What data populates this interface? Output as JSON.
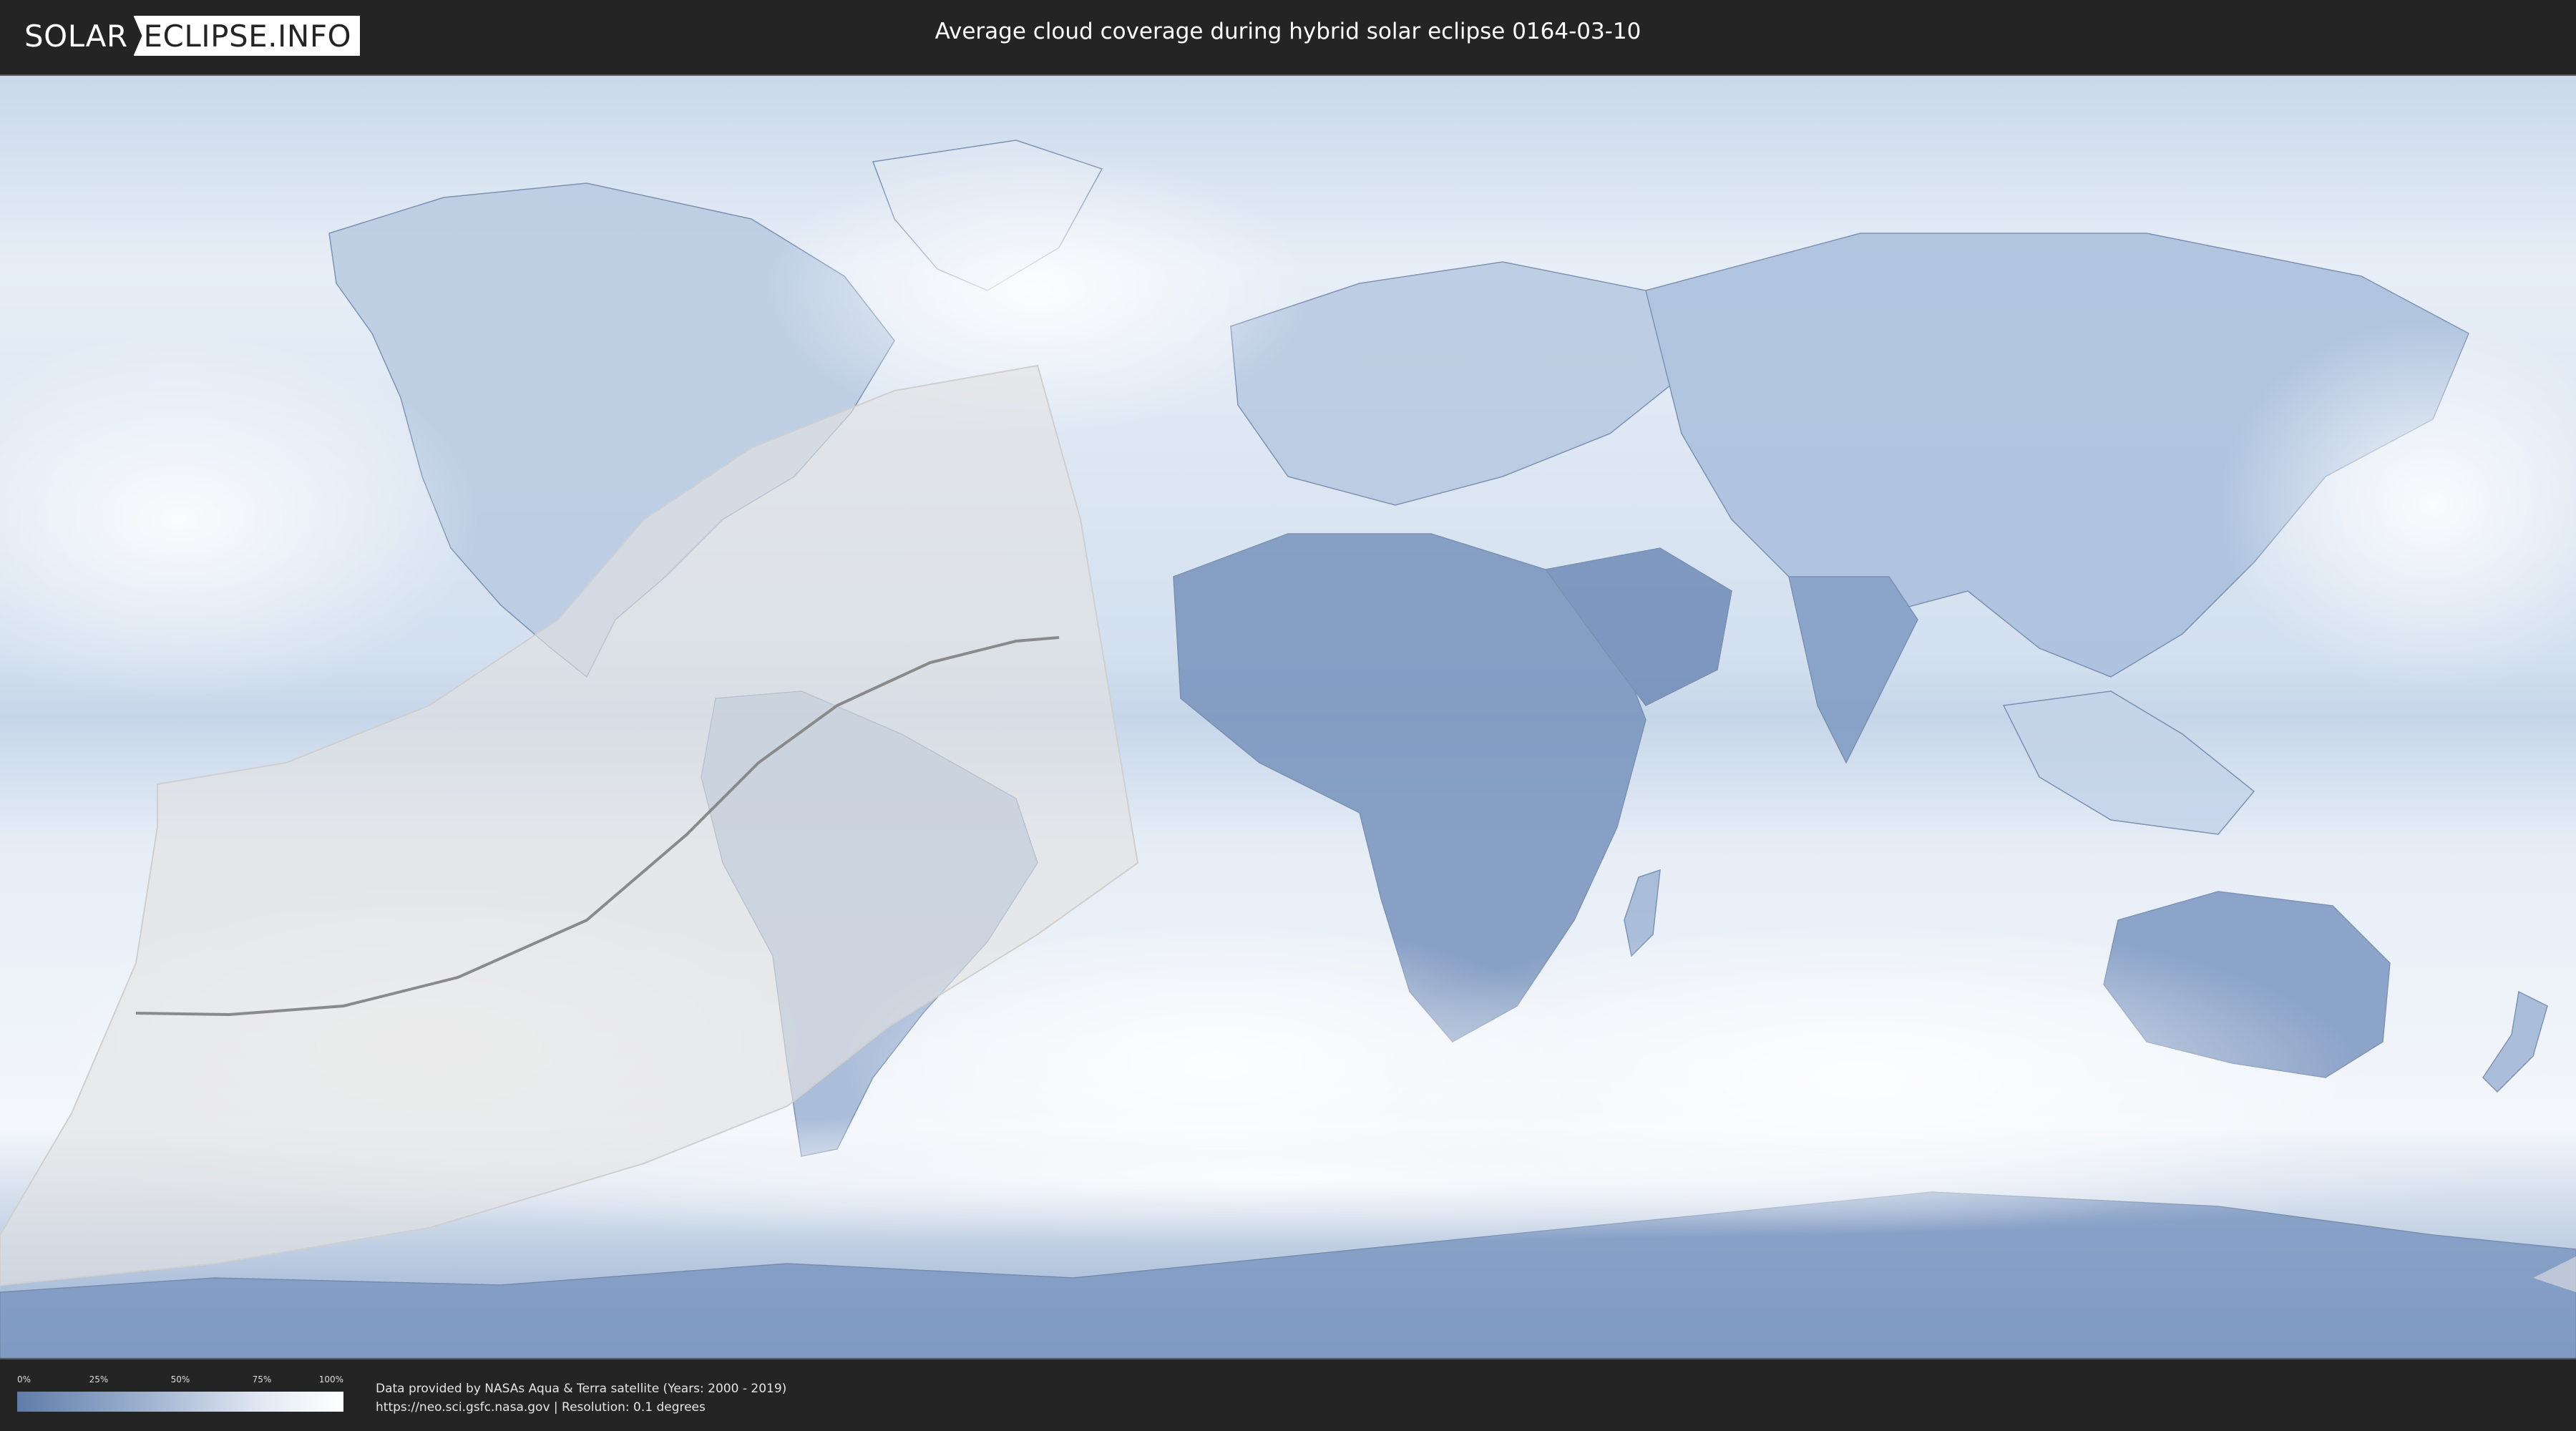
{
  "header": {
    "logo_solar": "SOLAR",
    "logo_eclipse": "ECLIPSE.INFO",
    "title": "Average cloud coverage during hybrid solar eclipse 0164-03-10"
  },
  "legend": {
    "ticks": [
      "0%",
      "25%",
      "50%",
      "75%",
      "100%"
    ],
    "colors": [
      "#5f7ca8",
      "#9fb3d0",
      "#e2e9f3",
      "#ffffff"
    ]
  },
  "credits": {
    "line1": "Data provided by NASAs Aqua & Terra satellite (Years: 2000 - 2019)",
    "line2": "https://neo.sci.gsfc.nasa.gov | Resolution: 0.1 degrees"
  },
  "map": {
    "projection": "equirectangular",
    "ocean_color": "#dfe8f3",
    "land_color": "#7d98c2",
    "shadow_color": "#dcdcdc",
    "eclipse_path_color": "#8a8a8a"
  }
}
